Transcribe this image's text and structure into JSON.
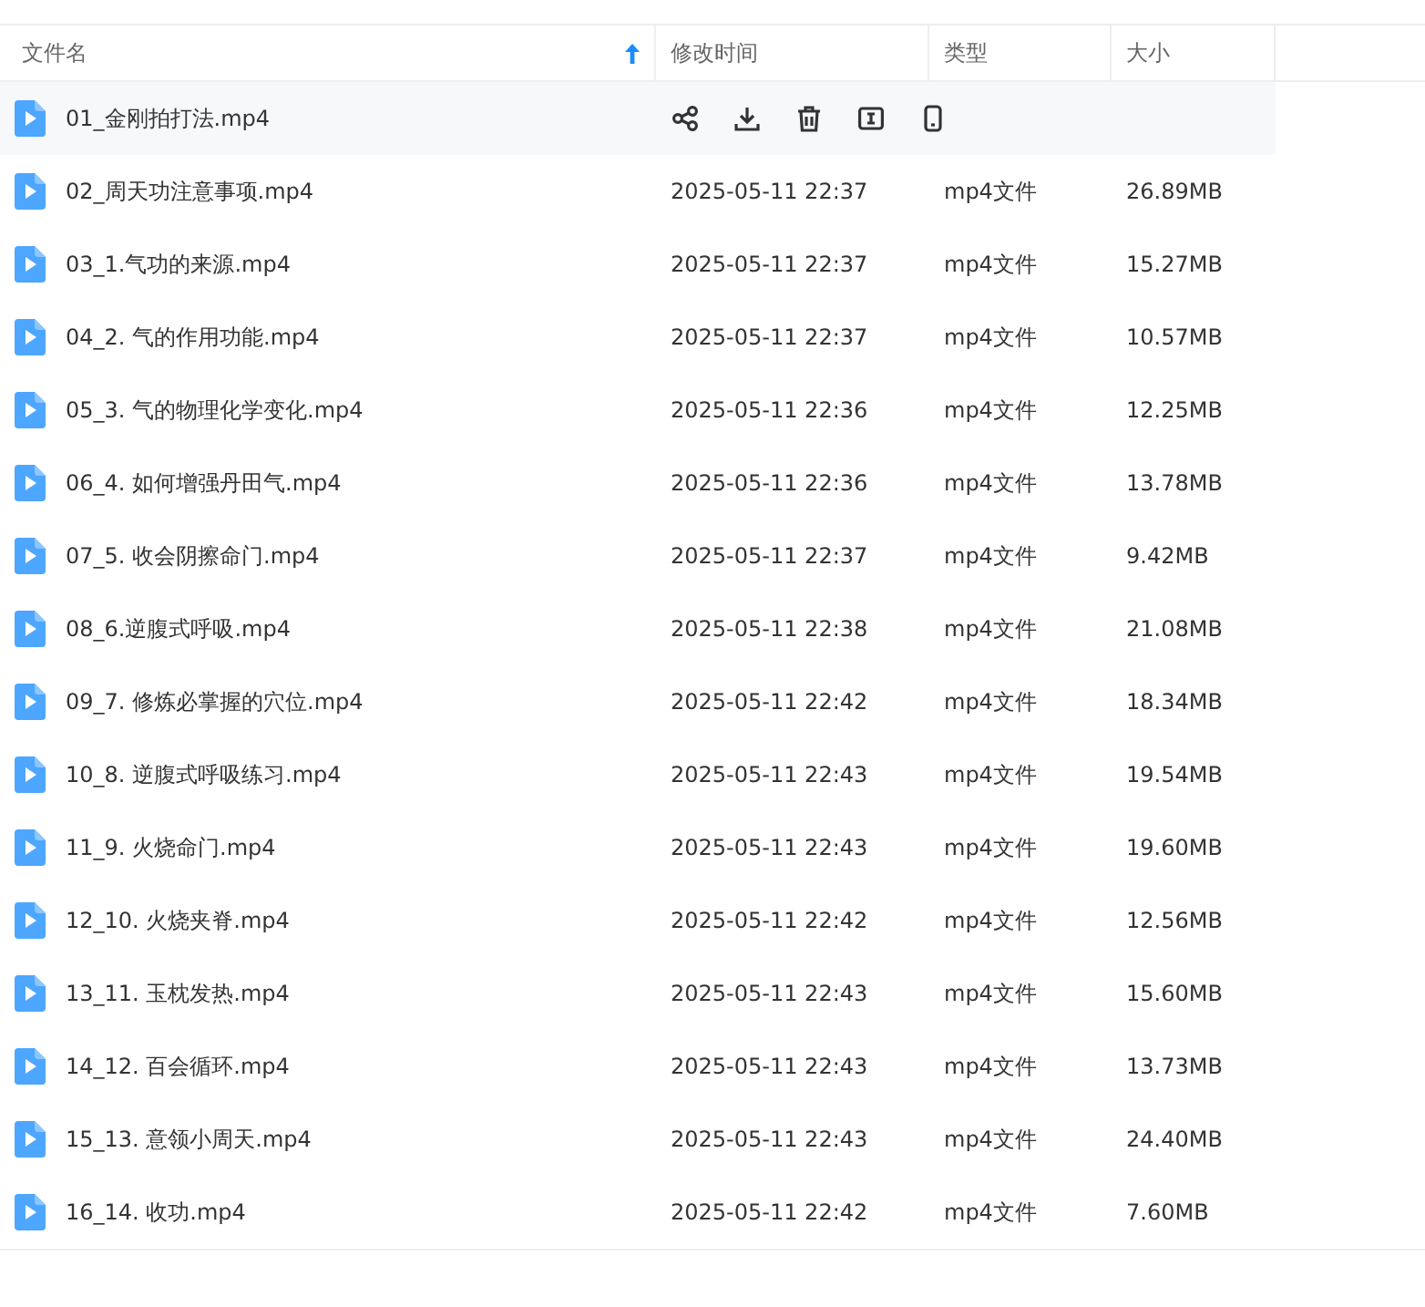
{
  "table": {
    "columns": [
      {
        "label": "文件名",
        "sort_ascending": true
      },
      {
        "label": "修改时间"
      },
      {
        "label": "类型"
      },
      {
        "label": "大小"
      }
    ],
    "rows": [
      {
        "name": "01_金刚拍打法.mp4",
        "hovered": true,
        "actions": [
          {
            "kind": "share"
          },
          {
            "kind": "download"
          },
          {
            "kind": "delete"
          },
          {
            "kind": "rename"
          },
          {
            "kind": "phone"
          }
        ]
      },
      {
        "name": "02_周天功注意事项.mp4",
        "hovered": false,
        "modified": "2025-05-11 22:37",
        "type": "mp4文件",
        "size": "26.89MB"
      },
      {
        "name": "03_1.气功的来源.mp4",
        "hovered": false,
        "modified": "2025-05-11 22:37",
        "type": "mp4文件",
        "size": "15.27MB"
      },
      {
        "name": "04_2. 气的作用功能.mp4",
        "hovered": false,
        "modified": "2025-05-11 22:37",
        "type": "mp4文件",
        "size": "10.57MB"
      },
      {
        "name": "05_3. 气的物理化学变化.mp4",
        "hovered": false,
        "modified": "2025-05-11 22:36",
        "type": "mp4文件",
        "size": "12.25MB"
      },
      {
        "name": "06_4. 如何增强丹田气.mp4",
        "hovered": false,
        "modified": "2025-05-11 22:36",
        "type": "mp4文件",
        "size": "13.78MB"
      },
      {
        "name": "07_5. 收会阴擦命门.mp4",
        "hovered": false,
        "modified": "2025-05-11 22:37",
        "type": "mp4文件",
        "size": "9.42MB"
      },
      {
        "name": "08_6.逆腹式呼吸.mp4",
        "hovered": false,
        "modified": "2025-05-11 22:38",
        "type": "mp4文件",
        "size": "21.08MB"
      },
      {
        "name": "09_7. 修炼必掌握的穴位.mp4",
        "hovered": false,
        "modified": "2025-05-11 22:42",
        "type": "mp4文件",
        "size": "18.34MB"
      },
      {
        "name": "10_8. 逆腹式呼吸练习.mp4",
        "hovered": false,
        "modified": "2025-05-11 22:43",
        "type": "mp4文件",
        "size": "19.54MB"
      },
      {
        "name": "11_9. 火烧命门.mp4",
        "hovered": false,
        "modified": "2025-05-11 22:43",
        "type": "mp4文件",
        "size": "19.60MB"
      },
      {
        "name": "12_10. 火烧夹脊.mp4",
        "hovered": false,
        "modified": "2025-05-11 22:42",
        "type": "mp4文件",
        "size": "12.56MB"
      },
      {
        "name": "13_11. 玉枕发热.mp4",
        "hovered": false,
        "modified": "2025-05-11 22:43",
        "type": "mp4文件",
        "size": "15.60MB"
      },
      {
        "name": "14_12. 百会循环.mp4",
        "hovered": false,
        "modified": "2025-05-11 22:43",
        "type": "mp4文件",
        "size": "13.73MB"
      },
      {
        "name": "15_13. 意领小周天.mp4",
        "hovered": false,
        "modified": "2025-05-11 22:43",
        "type": "mp4文件",
        "size": "24.40MB"
      },
      {
        "name": "16_14. 收功.mp4",
        "hovered": false,
        "modified": "2025-05-11 22:42",
        "type": "mp4文件",
        "size": "7.60MB"
      }
    ]
  }
}
